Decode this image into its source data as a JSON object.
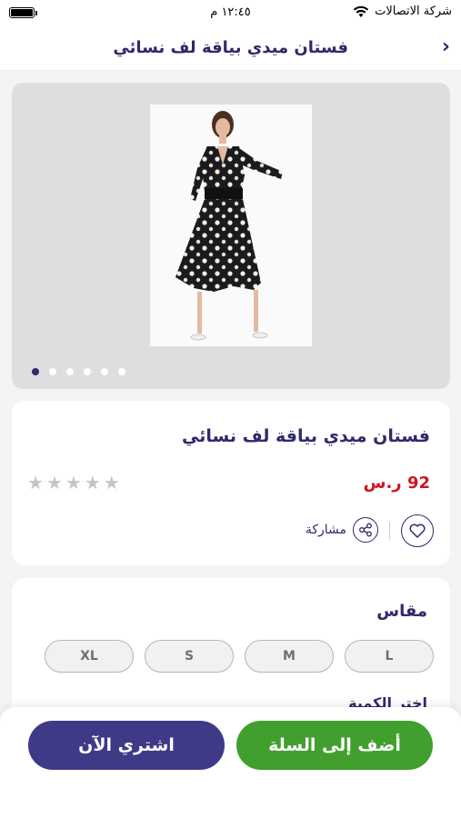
{
  "status_bar": {
    "carrier": "شركة الاتصالات",
    "time": "١٢:٤٥ م"
  },
  "header": {
    "title": "فستان ميدي بياقة لف نسائي"
  },
  "gallery": {
    "image_count": 6,
    "active_index": 0
  },
  "product": {
    "title": "فستان ميدي بياقة لف نسائي",
    "price": "92 ر.س",
    "rating": 0,
    "rating_max": 5,
    "share_label": "مشاركة"
  },
  "size_section": {
    "label": "مقاس",
    "options": [
      "L",
      "M",
      "S",
      "XL"
    ]
  },
  "next_section": {
    "label": "اختر الكمية"
  },
  "actions": {
    "add_to_cart": "أضف إلى السلة",
    "buy_now": "اشتري الآن"
  },
  "colors": {
    "primary": "#2e2a6b",
    "cart_button": "#41a02d",
    "buy_button": "#3f3a87",
    "price": "#d2141e"
  }
}
